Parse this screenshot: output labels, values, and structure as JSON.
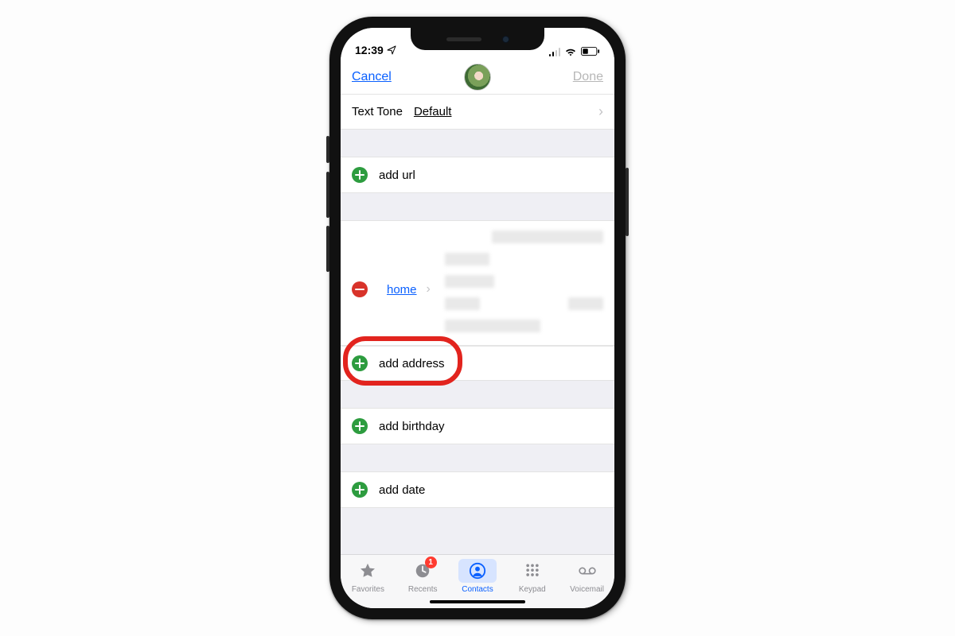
{
  "status": {
    "time": "12:39"
  },
  "nav": {
    "cancel": "Cancel",
    "done": "Done"
  },
  "tone_row": {
    "label": "Text Tone",
    "value": "Default"
  },
  "add_url": {
    "label": "add url"
  },
  "address_group": {
    "existing": {
      "label": "home"
    },
    "add": {
      "label": "add address"
    }
  },
  "add_birthday": {
    "label": "add birthday"
  },
  "add_date": {
    "label": "add date"
  },
  "tabs": {
    "favorites": "Favorites",
    "recents": "Recents",
    "recents_badge": "1",
    "contacts": "Contacts",
    "keypad": "Keypad",
    "voicemail": "Voicemail"
  }
}
